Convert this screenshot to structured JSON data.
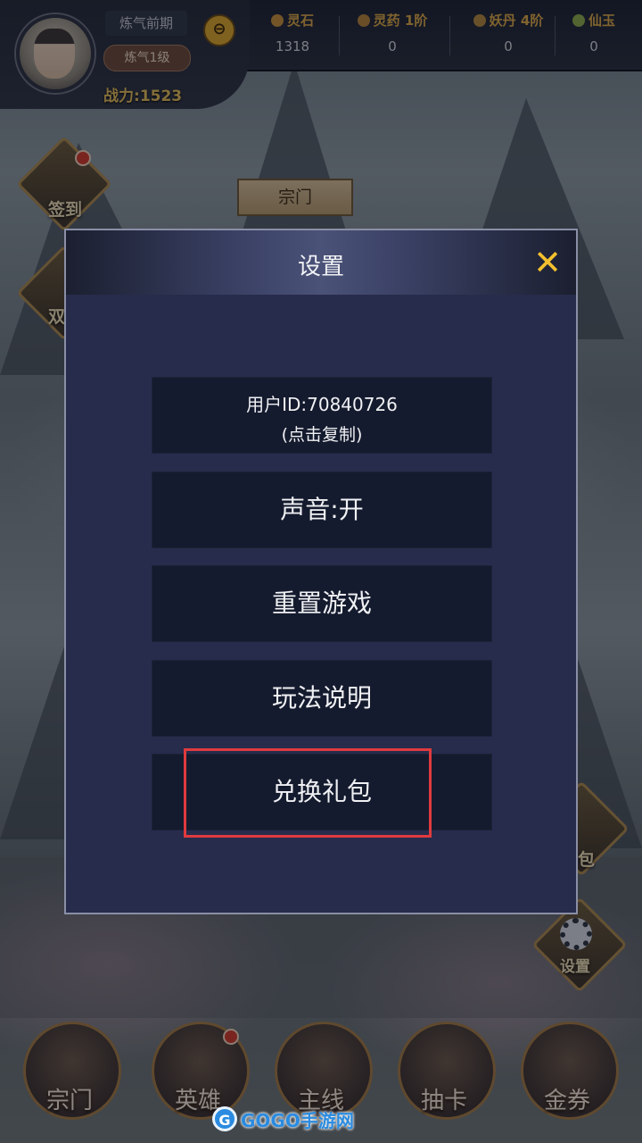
{
  "header": {
    "realm": "炼气前期",
    "level": "炼气1级",
    "power_label": "战力:",
    "power_value": "1523",
    "resources": [
      {
        "label": "灵石",
        "value": "1318",
        "icon": "spirit-stone-icon",
        "color": "#c9923a"
      },
      {
        "label": "灵药 1阶",
        "value": "0",
        "icon": "herb-icon",
        "color": "#b8853a"
      },
      {
        "label": "妖丹 4阶",
        "value": "0",
        "icon": "demon-core-icon",
        "color": "#b48a3c"
      },
      {
        "label": "仙玉",
        "value": "0",
        "icon": "jade-icon",
        "color": "#8fb04a"
      }
    ]
  },
  "map": {
    "sign_in": "签到",
    "double": "双",
    "sect_banner": "宗门",
    "gift": "包",
    "settings": "设置"
  },
  "dialog": {
    "title": "设置",
    "close_icon": "close-icon",
    "buttons": {
      "user_id_line1": "用户ID:70840726",
      "user_id_line2": "(点击复制)",
      "sound": "声音:开",
      "reset": "重置游戏",
      "guide": "玩法说明",
      "redeem": "兑换礼包"
    },
    "highlight_color": "#e03a3e"
  },
  "bottom_nav": [
    {
      "label": "宗门"
    },
    {
      "label": "英雄"
    },
    {
      "label": "主线"
    },
    {
      "label": "抽卡"
    },
    {
      "label": "金券"
    }
  ],
  "watermark": {
    "logo": "G",
    "text": "GOGO手游网"
  }
}
